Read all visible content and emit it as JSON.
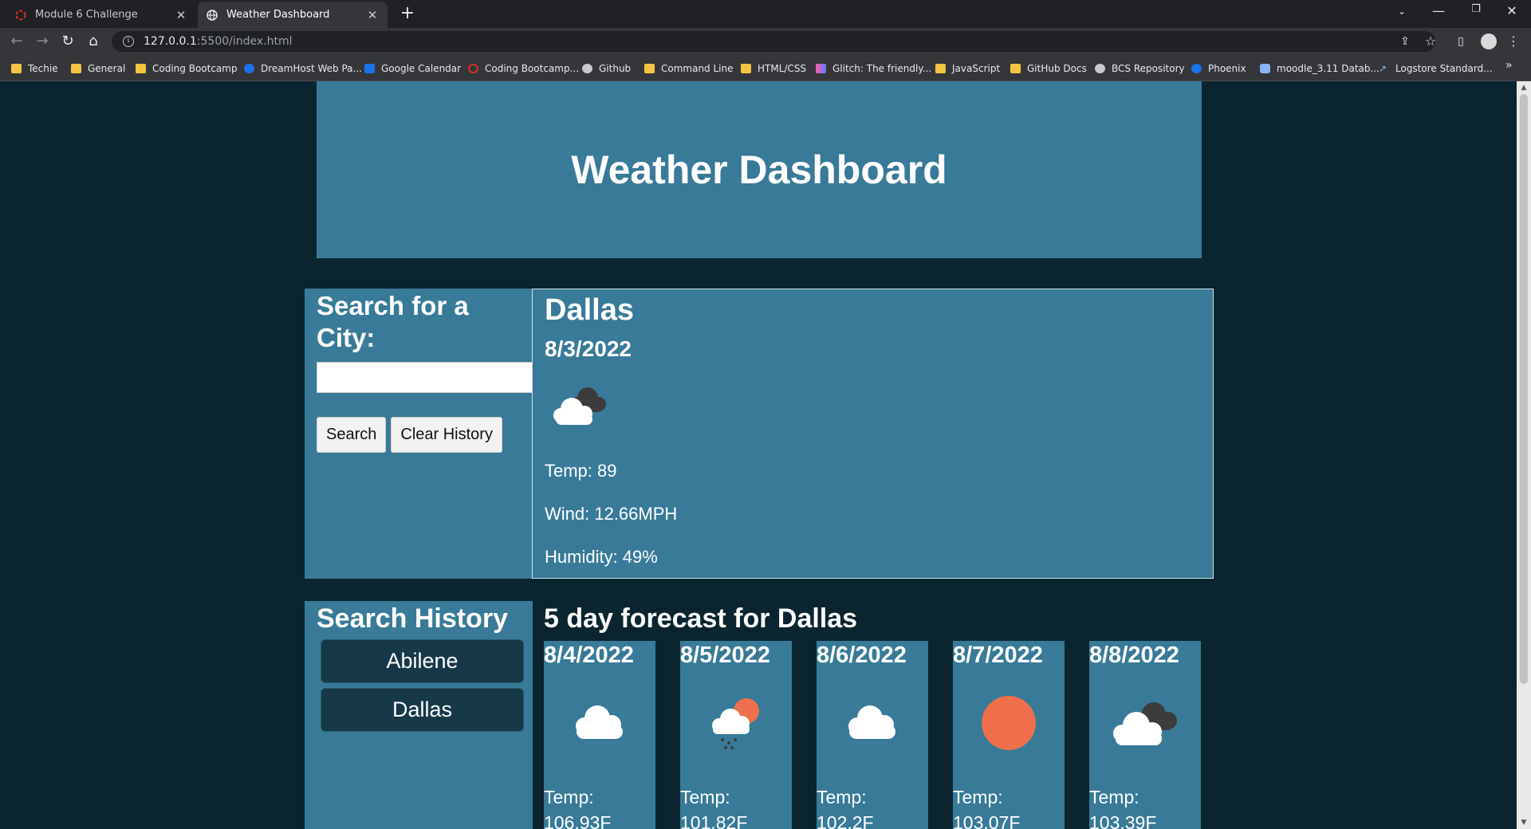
{
  "browser": {
    "tabs": [
      {
        "title": "Module 6 Challenge",
        "icon": "ring-icon"
      },
      {
        "title": "Weather Dashboard",
        "icon": "globe-icon"
      }
    ],
    "url_host": "127.0.0.1",
    "url_path": ":5500/index.html",
    "bookmarks": [
      {
        "label": "Techie",
        "icon": "folder"
      },
      {
        "label": "General",
        "icon": "folder"
      },
      {
        "label": "Coding Bootcamp",
        "icon": "folder"
      },
      {
        "label": "DreamHost Web Pa...",
        "icon": "globe"
      },
      {
        "label": "Google Calendar",
        "icon": "calendar"
      },
      {
        "label": "Coding Bootcamp...",
        "icon": "ring"
      },
      {
        "label": "Github",
        "icon": "github"
      },
      {
        "label": "Command Line",
        "icon": "folder"
      },
      {
        "label": "HTML/CSS",
        "icon": "folder"
      },
      {
        "label": "Glitch: The friendly...",
        "icon": "glitch"
      },
      {
        "label": "JavaScript",
        "icon": "folder"
      },
      {
        "label": "GitHub Docs",
        "icon": "folder"
      },
      {
        "label": "BCS Repository",
        "icon": "github"
      },
      {
        "label": "Phoenix",
        "icon": "globe"
      },
      {
        "label": "moodle_3.11 Datab...",
        "icon": "database"
      },
      {
        "label": "Logstore Standard...",
        "icon": "arrow"
      }
    ]
  },
  "page": {
    "title": "Weather Dashboard",
    "search": {
      "label": "Search for a City:",
      "input_value": "",
      "search_button": "Search",
      "clear_button": "Clear History"
    },
    "current": {
      "city": "Dallas",
      "date": "8/3/2022",
      "icon": "broken-clouds-icon",
      "temp": "Temp: 89",
      "wind": "Wind: 12.66MPH",
      "humidity": "Humidity: 49%"
    },
    "history": {
      "title": "Search History",
      "items": [
        "Abilene",
        "Dallas"
      ]
    },
    "forecast": {
      "title": "5 day forecast for Dallas",
      "days": [
        {
          "date": "8/4/2022",
          "icon": "cloud-icon",
          "temp": "Temp: 106.93F"
        },
        {
          "date": "8/5/2022",
          "icon": "sun-rain-cloud-icon",
          "temp": "Temp: 101.82F"
        },
        {
          "date": "8/6/2022",
          "icon": "cloud-icon",
          "temp": "Temp: 102.2F"
        },
        {
          "date": "8/7/2022",
          "icon": "sun-icon",
          "temp": "Temp: 103.07F"
        },
        {
          "date": "8/8/2022",
          "icon": "broken-clouds-icon",
          "temp": "Temp: 103.39F"
        }
      ]
    }
  },
  "colors": {
    "page_bg": "#0b2530",
    "panel": "#387a98",
    "history_button": "#163847",
    "sun": "#ef6f4c",
    "cloud": "#ffffff",
    "dark_cloud": "#3c3c3c"
  }
}
